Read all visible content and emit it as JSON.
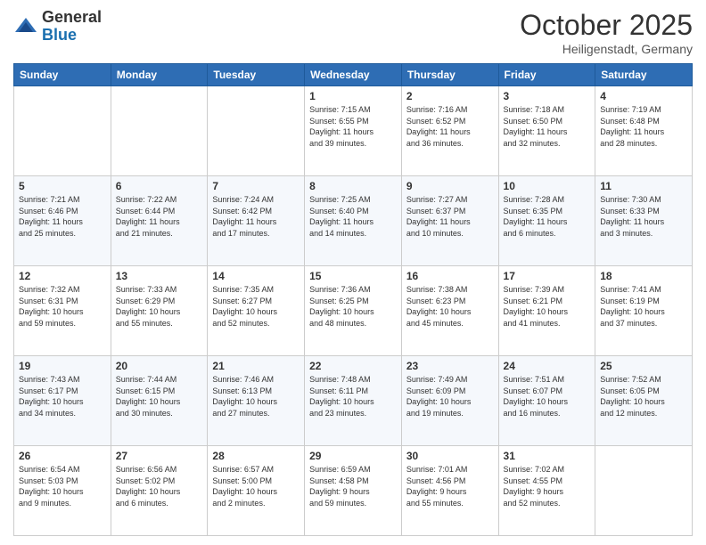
{
  "header": {
    "logo": {
      "general": "General",
      "blue": "Blue"
    },
    "title": "October 2025",
    "subtitle": "Heiligenstadt, Germany"
  },
  "days_of_week": [
    "Sunday",
    "Monday",
    "Tuesday",
    "Wednesday",
    "Thursday",
    "Friday",
    "Saturday"
  ],
  "weeks": [
    [
      {
        "num": "",
        "info": ""
      },
      {
        "num": "",
        "info": ""
      },
      {
        "num": "",
        "info": ""
      },
      {
        "num": "1",
        "info": "Sunrise: 7:15 AM\nSunset: 6:55 PM\nDaylight: 11 hours\nand 39 minutes."
      },
      {
        "num": "2",
        "info": "Sunrise: 7:16 AM\nSunset: 6:52 PM\nDaylight: 11 hours\nand 36 minutes."
      },
      {
        "num": "3",
        "info": "Sunrise: 7:18 AM\nSunset: 6:50 PM\nDaylight: 11 hours\nand 32 minutes."
      },
      {
        "num": "4",
        "info": "Sunrise: 7:19 AM\nSunset: 6:48 PM\nDaylight: 11 hours\nand 28 minutes."
      }
    ],
    [
      {
        "num": "5",
        "info": "Sunrise: 7:21 AM\nSunset: 6:46 PM\nDaylight: 11 hours\nand 25 minutes."
      },
      {
        "num": "6",
        "info": "Sunrise: 7:22 AM\nSunset: 6:44 PM\nDaylight: 11 hours\nand 21 minutes."
      },
      {
        "num": "7",
        "info": "Sunrise: 7:24 AM\nSunset: 6:42 PM\nDaylight: 11 hours\nand 17 minutes."
      },
      {
        "num": "8",
        "info": "Sunrise: 7:25 AM\nSunset: 6:40 PM\nDaylight: 11 hours\nand 14 minutes."
      },
      {
        "num": "9",
        "info": "Sunrise: 7:27 AM\nSunset: 6:37 PM\nDaylight: 11 hours\nand 10 minutes."
      },
      {
        "num": "10",
        "info": "Sunrise: 7:28 AM\nSunset: 6:35 PM\nDaylight: 11 hours\nand 6 minutes."
      },
      {
        "num": "11",
        "info": "Sunrise: 7:30 AM\nSunset: 6:33 PM\nDaylight: 11 hours\nand 3 minutes."
      }
    ],
    [
      {
        "num": "12",
        "info": "Sunrise: 7:32 AM\nSunset: 6:31 PM\nDaylight: 10 hours\nand 59 minutes."
      },
      {
        "num": "13",
        "info": "Sunrise: 7:33 AM\nSunset: 6:29 PM\nDaylight: 10 hours\nand 55 minutes."
      },
      {
        "num": "14",
        "info": "Sunrise: 7:35 AM\nSunset: 6:27 PM\nDaylight: 10 hours\nand 52 minutes."
      },
      {
        "num": "15",
        "info": "Sunrise: 7:36 AM\nSunset: 6:25 PM\nDaylight: 10 hours\nand 48 minutes."
      },
      {
        "num": "16",
        "info": "Sunrise: 7:38 AM\nSunset: 6:23 PM\nDaylight: 10 hours\nand 45 minutes."
      },
      {
        "num": "17",
        "info": "Sunrise: 7:39 AM\nSunset: 6:21 PM\nDaylight: 10 hours\nand 41 minutes."
      },
      {
        "num": "18",
        "info": "Sunrise: 7:41 AM\nSunset: 6:19 PM\nDaylight: 10 hours\nand 37 minutes."
      }
    ],
    [
      {
        "num": "19",
        "info": "Sunrise: 7:43 AM\nSunset: 6:17 PM\nDaylight: 10 hours\nand 34 minutes."
      },
      {
        "num": "20",
        "info": "Sunrise: 7:44 AM\nSunset: 6:15 PM\nDaylight: 10 hours\nand 30 minutes."
      },
      {
        "num": "21",
        "info": "Sunrise: 7:46 AM\nSunset: 6:13 PM\nDaylight: 10 hours\nand 27 minutes."
      },
      {
        "num": "22",
        "info": "Sunrise: 7:48 AM\nSunset: 6:11 PM\nDaylight: 10 hours\nand 23 minutes."
      },
      {
        "num": "23",
        "info": "Sunrise: 7:49 AM\nSunset: 6:09 PM\nDaylight: 10 hours\nand 19 minutes."
      },
      {
        "num": "24",
        "info": "Sunrise: 7:51 AM\nSunset: 6:07 PM\nDaylight: 10 hours\nand 16 minutes."
      },
      {
        "num": "25",
        "info": "Sunrise: 7:52 AM\nSunset: 6:05 PM\nDaylight: 10 hours\nand 12 minutes."
      }
    ],
    [
      {
        "num": "26",
        "info": "Sunrise: 6:54 AM\nSunset: 5:03 PM\nDaylight: 10 hours\nand 9 minutes."
      },
      {
        "num": "27",
        "info": "Sunrise: 6:56 AM\nSunset: 5:02 PM\nDaylight: 10 hours\nand 6 minutes."
      },
      {
        "num": "28",
        "info": "Sunrise: 6:57 AM\nSunset: 5:00 PM\nDaylight: 10 hours\nand 2 minutes."
      },
      {
        "num": "29",
        "info": "Sunrise: 6:59 AM\nSunset: 4:58 PM\nDaylight: 9 hours\nand 59 minutes."
      },
      {
        "num": "30",
        "info": "Sunrise: 7:01 AM\nSunset: 4:56 PM\nDaylight: 9 hours\nand 55 minutes."
      },
      {
        "num": "31",
        "info": "Sunrise: 7:02 AM\nSunset: 4:55 PM\nDaylight: 9 hours\nand 52 minutes."
      },
      {
        "num": "",
        "info": ""
      }
    ]
  ]
}
